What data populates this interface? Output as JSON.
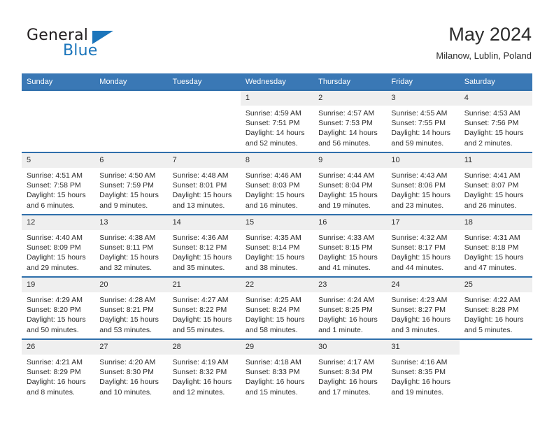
{
  "brand": {
    "name_top": "General",
    "name_bottom": "Blue",
    "accent_color": "#1b75bb",
    "triangle_icon": "brand-triangle-icon"
  },
  "header": {
    "title": "May 2024",
    "subtitle": "Milanow, Lublin, Poland"
  },
  "colors": {
    "header_row": "#3a78b5",
    "row_divider": "#2f6fab",
    "daynum_band": "#efefef",
    "text": "#2b2b2b"
  },
  "weekday_headers": [
    "Sunday",
    "Monday",
    "Tuesday",
    "Wednesday",
    "Thursday",
    "Friday",
    "Saturday"
  ],
  "weeks": [
    [
      {
        "day": "",
        "empty": true
      },
      {
        "day": "",
        "empty": true
      },
      {
        "day": "",
        "empty": true
      },
      {
        "day": "1",
        "sunrise": "Sunrise: 4:59 AM",
        "sunset": "Sunset: 7:51 PM",
        "daylight": "Daylight: 14 hours and 52 minutes."
      },
      {
        "day": "2",
        "sunrise": "Sunrise: 4:57 AM",
        "sunset": "Sunset: 7:53 PM",
        "daylight": "Daylight: 14 hours and 56 minutes."
      },
      {
        "day": "3",
        "sunrise": "Sunrise: 4:55 AM",
        "sunset": "Sunset: 7:55 PM",
        "daylight": "Daylight: 14 hours and 59 minutes."
      },
      {
        "day": "4",
        "sunrise": "Sunrise: 4:53 AM",
        "sunset": "Sunset: 7:56 PM",
        "daylight": "Daylight: 15 hours and 2 minutes."
      }
    ],
    [
      {
        "day": "5",
        "sunrise": "Sunrise: 4:51 AM",
        "sunset": "Sunset: 7:58 PM",
        "daylight": "Daylight: 15 hours and 6 minutes."
      },
      {
        "day": "6",
        "sunrise": "Sunrise: 4:50 AM",
        "sunset": "Sunset: 7:59 PM",
        "daylight": "Daylight: 15 hours and 9 minutes."
      },
      {
        "day": "7",
        "sunrise": "Sunrise: 4:48 AM",
        "sunset": "Sunset: 8:01 PM",
        "daylight": "Daylight: 15 hours and 13 minutes."
      },
      {
        "day": "8",
        "sunrise": "Sunrise: 4:46 AM",
        "sunset": "Sunset: 8:03 PM",
        "daylight": "Daylight: 15 hours and 16 minutes."
      },
      {
        "day": "9",
        "sunrise": "Sunrise: 4:44 AM",
        "sunset": "Sunset: 8:04 PM",
        "daylight": "Daylight: 15 hours and 19 minutes."
      },
      {
        "day": "10",
        "sunrise": "Sunrise: 4:43 AM",
        "sunset": "Sunset: 8:06 PM",
        "daylight": "Daylight: 15 hours and 23 minutes."
      },
      {
        "day": "11",
        "sunrise": "Sunrise: 4:41 AM",
        "sunset": "Sunset: 8:07 PM",
        "daylight": "Daylight: 15 hours and 26 minutes."
      }
    ],
    [
      {
        "day": "12",
        "sunrise": "Sunrise: 4:40 AM",
        "sunset": "Sunset: 8:09 PM",
        "daylight": "Daylight: 15 hours and 29 minutes."
      },
      {
        "day": "13",
        "sunrise": "Sunrise: 4:38 AM",
        "sunset": "Sunset: 8:11 PM",
        "daylight": "Daylight: 15 hours and 32 minutes."
      },
      {
        "day": "14",
        "sunrise": "Sunrise: 4:36 AM",
        "sunset": "Sunset: 8:12 PM",
        "daylight": "Daylight: 15 hours and 35 minutes."
      },
      {
        "day": "15",
        "sunrise": "Sunrise: 4:35 AM",
        "sunset": "Sunset: 8:14 PM",
        "daylight": "Daylight: 15 hours and 38 minutes."
      },
      {
        "day": "16",
        "sunrise": "Sunrise: 4:33 AM",
        "sunset": "Sunset: 8:15 PM",
        "daylight": "Daylight: 15 hours and 41 minutes."
      },
      {
        "day": "17",
        "sunrise": "Sunrise: 4:32 AM",
        "sunset": "Sunset: 8:17 PM",
        "daylight": "Daylight: 15 hours and 44 minutes."
      },
      {
        "day": "18",
        "sunrise": "Sunrise: 4:31 AM",
        "sunset": "Sunset: 8:18 PM",
        "daylight": "Daylight: 15 hours and 47 minutes."
      }
    ],
    [
      {
        "day": "19",
        "sunrise": "Sunrise: 4:29 AM",
        "sunset": "Sunset: 8:20 PM",
        "daylight": "Daylight: 15 hours and 50 minutes."
      },
      {
        "day": "20",
        "sunrise": "Sunrise: 4:28 AM",
        "sunset": "Sunset: 8:21 PM",
        "daylight": "Daylight: 15 hours and 53 minutes."
      },
      {
        "day": "21",
        "sunrise": "Sunrise: 4:27 AM",
        "sunset": "Sunset: 8:22 PM",
        "daylight": "Daylight: 15 hours and 55 minutes."
      },
      {
        "day": "22",
        "sunrise": "Sunrise: 4:25 AM",
        "sunset": "Sunset: 8:24 PM",
        "daylight": "Daylight: 15 hours and 58 minutes."
      },
      {
        "day": "23",
        "sunrise": "Sunrise: 4:24 AM",
        "sunset": "Sunset: 8:25 PM",
        "daylight": "Daylight: 16 hours and 1 minute."
      },
      {
        "day": "24",
        "sunrise": "Sunrise: 4:23 AM",
        "sunset": "Sunset: 8:27 PM",
        "daylight": "Daylight: 16 hours and 3 minutes."
      },
      {
        "day": "25",
        "sunrise": "Sunrise: 4:22 AM",
        "sunset": "Sunset: 8:28 PM",
        "daylight": "Daylight: 16 hours and 5 minutes."
      }
    ],
    [
      {
        "day": "26",
        "sunrise": "Sunrise: 4:21 AM",
        "sunset": "Sunset: 8:29 PM",
        "daylight": "Daylight: 16 hours and 8 minutes."
      },
      {
        "day": "27",
        "sunrise": "Sunrise: 4:20 AM",
        "sunset": "Sunset: 8:30 PM",
        "daylight": "Daylight: 16 hours and 10 minutes."
      },
      {
        "day": "28",
        "sunrise": "Sunrise: 4:19 AM",
        "sunset": "Sunset: 8:32 PM",
        "daylight": "Daylight: 16 hours and 12 minutes."
      },
      {
        "day": "29",
        "sunrise": "Sunrise: 4:18 AM",
        "sunset": "Sunset: 8:33 PM",
        "daylight": "Daylight: 16 hours and 15 minutes."
      },
      {
        "day": "30",
        "sunrise": "Sunrise: 4:17 AM",
        "sunset": "Sunset: 8:34 PM",
        "daylight": "Daylight: 16 hours and 17 minutes."
      },
      {
        "day": "31",
        "sunrise": "Sunrise: 4:16 AM",
        "sunset": "Sunset: 8:35 PM",
        "daylight": "Daylight: 16 hours and 19 minutes."
      },
      {
        "day": "",
        "empty": true
      }
    ]
  ]
}
